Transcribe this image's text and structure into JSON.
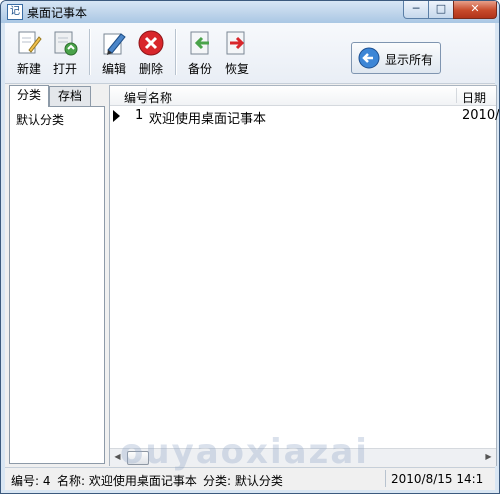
{
  "window": {
    "title": "桌面记事本",
    "app_icon": "记",
    "min": "─",
    "max": "□",
    "close": "✕"
  },
  "toolbar": {
    "new": "新建",
    "open": "打开",
    "edit": "编辑",
    "delete": "删除",
    "backup": "备份",
    "restore": "恢复",
    "show_all": "显示所有"
  },
  "tabs": {
    "category": "分类",
    "archive": "存档"
  },
  "categories": [
    "默认分类"
  ],
  "list": {
    "headers": {
      "number": "编号",
      "name": "名称",
      "date": "日期"
    },
    "rows": [
      {
        "number": "1",
        "name": "欢迎使用桌面记事本",
        "date": "2010/"
      }
    ]
  },
  "statusbar": {
    "number": "编号: 4",
    "name": "名称: 欢迎使用桌面记事本",
    "category": "分类: 默认分类",
    "datetime": "2010/8/15 14:1"
  },
  "watermark": "ouyaoxiazai",
  "colors": {
    "accent": "#3b6ea5",
    "delete_red": "#d8262b",
    "backup_green": "#4aa34a"
  }
}
